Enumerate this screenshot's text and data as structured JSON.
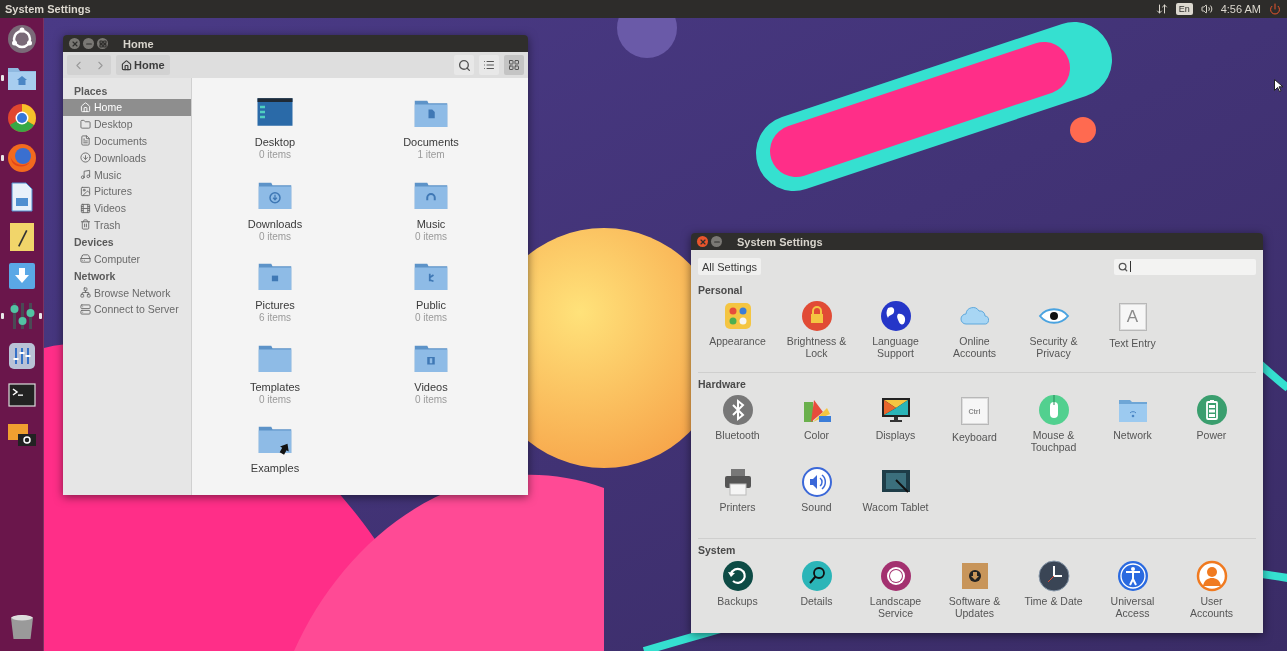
{
  "top_bar": {
    "title": "System Settings",
    "keyboard_layout": "En",
    "time": "4:56 AM"
  },
  "launcher": {
    "items": [
      {
        "kind": "ubuntu",
        "running": false,
        "focused": false
      },
      {
        "kind": "files",
        "running": true,
        "focused": false
      },
      {
        "kind": "chrome",
        "running": false,
        "focused": false
      },
      {
        "kind": "firefox",
        "running": true,
        "focused": false
      },
      {
        "kind": "writer",
        "running": false,
        "focused": false
      },
      {
        "kind": "notes",
        "running": false,
        "focused": false
      },
      {
        "kind": "download",
        "running": false,
        "focused": false
      },
      {
        "kind": "mixer",
        "running": true,
        "focused": true
      },
      {
        "kind": "equalizer",
        "running": false,
        "focused": false
      },
      {
        "kind": "terminal",
        "running": false,
        "focused": false
      },
      {
        "kind": "screenshot",
        "running": false,
        "focused": false
      },
      {
        "kind": "trash",
        "running": false,
        "focused": false
      }
    ]
  },
  "files_window": {
    "title": "Home",
    "focused": false,
    "buttons": [
      {
        "kind": "close"
      },
      {
        "kind": "minimize"
      },
      {
        "kind": "maximize"
      }
    ],
    "path": "Home",
    "view_buttons": [
      {
        "kind": "list",
        "selected": false
      },
      {
        "kind": "grid",
        "selected": true
      }
    ],
    "sidebar": [
      {
        "heading": "Places",
        "items": [
          {
            "label": "Home",
            "kind": "home",
            "selected": true
          },
          {
            "label": "Desktop",
            "kind": "folder",
            "selected": false
          },
          {
            "label": "Documents",
            "kind": "document",
            "selected": false
          },
          {
            "label": "Downloads",
            "kind": "download",
            "selected": false
          },
          {
            "label": "Music",
            "kind": "music",
            "selected": false
          },
          {
            "label": "Pictures",
            "kind": "picture",
            "selected": false
          },
          {
            "label": "Videos",
            "kind": "video",
            "selected": false
          },
          {
            "label": "Trash",
            "kind": "trash",
            "selected": false
          }
        ]
      },
      {
        "heading": "Devices",
        "items": [
          {
            "label": "Computer",
            "kind": "drive",
            "selected": false
          }
        ]
      },
      {
        "heading": "Network",
        "items": [
          {
            "label": "Browse Network",
            "kind": "network",
            "selected": false
          },
          {
            "label": "Connect to Server",
            "kind": "server",
            "selected": false
          }
        ]
      }
    ],
    "items": [
      {
        "name": "Desktop",
        "count": "0 items",
        "kind": "desktop"
      },
      {
        "name": "Documents",
        "count": "1 item",
        "kind": "documents"
      },
      {
        "name": "Downloads",
        "count": "0 items",
        "kind": "downloads"
      },
      {
        "name": "Music",
        "count": "0 items",
        "kind": "music"
      },
      {
        "name": "Pictures",
        "count": "6 items",
        "kind": "pictures"
      },
      {
        "name": "Public",
        "count": "0 items",
        "kind": "public"
      },
      {
        "name": "Templates",
        "count": "0 items",
        "kind": "templates"
      },
      {
        "name": "Videos",
        "count": "0 items",
        "kind": "videos"
      },
      {
        "name": "Examples",
        "kind": "link"
      }
    ]
  },
  "settings_window": {
    "title": "System Settings",
    "focused": true,
    "buttons": [
      {
        "kind": "close"
      },
      {
        "kind": "minimize"
      }
    ],
    "all_settings": "All Settings",
    "search": {
      "focused": true
    },
    "sections": [
      {
        "heading": "Personal",
        "items": [
          {
            "label": "Appearance",
            "kind": "appearance"
          },
          {
            "label": "Brightness & Lock",
            "kind": "brightness"
          },
          {
            "label": "Language Support",
            "kind": "language"
          },
          {
            "label": "Online Accounts",
            "kind": "online"
          },
          {
            "label": "Security & Privacy",
            "kind": "security"
          },
          {
            "label": "Text Entry",
            "kind": "text",
            "glyph": "A"
          }
        ]
      },
      {
        "heading": "Hardware",
        "items": [
          {
            "label": "Bluetooth",
            "kind": "bluetooth"
          },
          {
            "label": "Color",
            "kind": "color"
          },
          {
            "label": "Displays",
            "kind": "displays"
          },
          {
            "label": "Keyboard",
            "kind": "keyboard",
            "glyph": "Ctrl"
          },
          {
            "label": "Mouse & Touchpad",
            "kind": "mouse"
          },
          {
            "label": "Network",
            "kind": "network"
          },
          {
            "label": "Power",
            "kind": "power"
          },
          {
            "label": "Printers",
            "kind": "printers"
          },
          {
            "label": "Sound",
            "kind": "sound"
          },
          {
            "label": "Wacom Tablet",
            "kind": "wacom"
          }
        ]
      },
      {
        "heading": "System",
        "items": [
          {
            "label": "Backups",
            "kind": "backups"
          },
          {
            "label": "Details",
            "kind": "details"
          },
          {
            "label": "Landscape Service",
            "kind": "landscape"
          },
          {
            "label": "Software & Updates",
            "kind": "software"
          },
          {
            "label": "Time & Date",
            "kind": "time"
          },
          {
            "label": "Universal Access",
            "kind": "universal"
          },
          {
            "label": "User Accounts",
            "kind": "user"
          }
        ]
      }
    ]
  }
}
